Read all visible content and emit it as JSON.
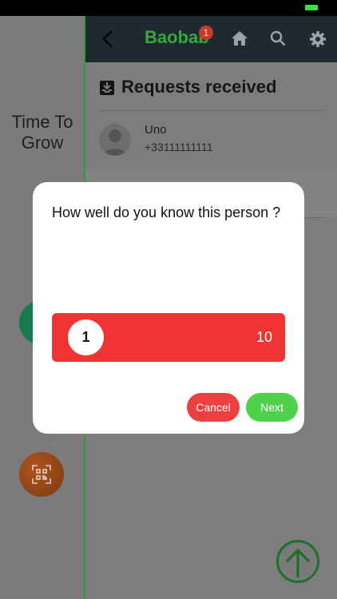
{
  "sidebar": {
    "brand_text": "Time To Grow"
  },
  "header": {
    "brand": "Baobab",
    "notification_count": "1"
  },
  "requests": {
    "title": "Requests received",
    "items": [
      {
        "name": "Uno",
        "phone": "+33111111111"
      }
    ]
  },
  "dialog": {
    "question": "How well do you know this person ?",
    "slider": {
      "value": "1",
      "max_label": "10"
    },
    "cancel_label": "Cancel",
    "next_label": "Next"
  },
  "colors": {
    "brand_green": "#3aa640",
    "slider_red": "#f03434",
    "cancel_red": "#ec3f3f",
    "next_green": "#4fd14b",
    "header_bg": "#1e2a30"
  },
  "icons": [
    "back-icon",
    "home-icon",
    "search-icon",
    "gear-icon",
    "inbox-icon",
    "qr-code-icon",
    "arrow-up-icon",
    "avatar-icon"
  ]
}
